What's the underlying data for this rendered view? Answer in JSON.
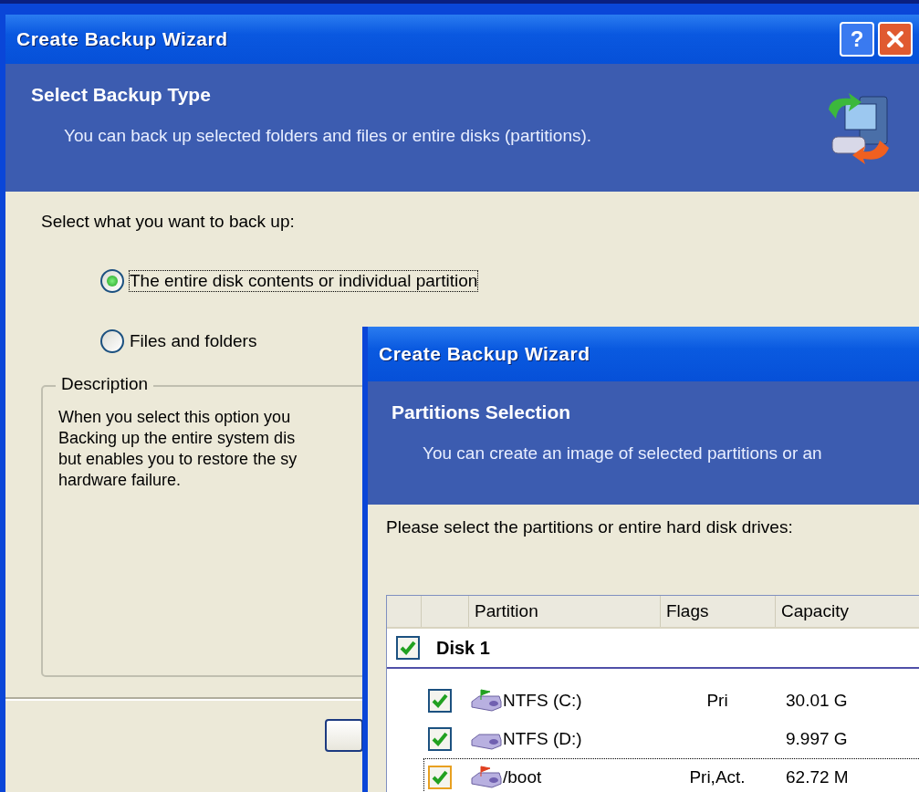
{
  "back_window": {
    "title": "Create Backup Wizard",
    "help_button": "?",
    "header": {
      "title": "Select Backup Type",
      "subtitle": "You can back up selected folders and files or entire disks (partitions)."
    },
    "prompt": "Select what you want to back up:",
    "options": [
      {
        "label": "The entire disk contents or individual partition",
        "selected": true,
        "focused": true
      },
      {
        "label": "Files and folders",
        "selected": false,
        "focused": false
      }
    ],
    "description": {
      "title": "Description",
      "text": "When you select this option you\nBacking up the entire system dis\nbut enables you to restore the sy\nhardware failure."
    }
  },
  "front_window": {
    "title": "Create Backup Wizard",
    "header": {
      "title": "Partitions Selection",
      "subtitle": "You can create an image of selected partitions or an"
    },
    "prompt": "Please select the partitions or entire hard disk drives:",
    "table": {
      "columns": [
        "Partition",
        "Flags",
        "Capacity"
      ],
      "disks": [
        {
          "name": "Disk 1",
          "checked": true,
          "partitions": [
            {
              "name": "NTFS (C:)",
              "flags": "Pri",
              "capacity": "30.01 G",
              "checked": true,
              "focused": false,
              "color": "#22a020"
            },
            {
              "name": "NTFS (D:)",
              "capacity": "9.997 G",
              "checked": true,
              "focused": false
            },
            {
              "name": "/boot",
              "flags": "Pri,Act.",
              "capacity": "62.72 M",
              "checked": true,
              "focused": true,
              "color": "#e04020"
            }
          ]
        }
      ]
    }
  }
}
